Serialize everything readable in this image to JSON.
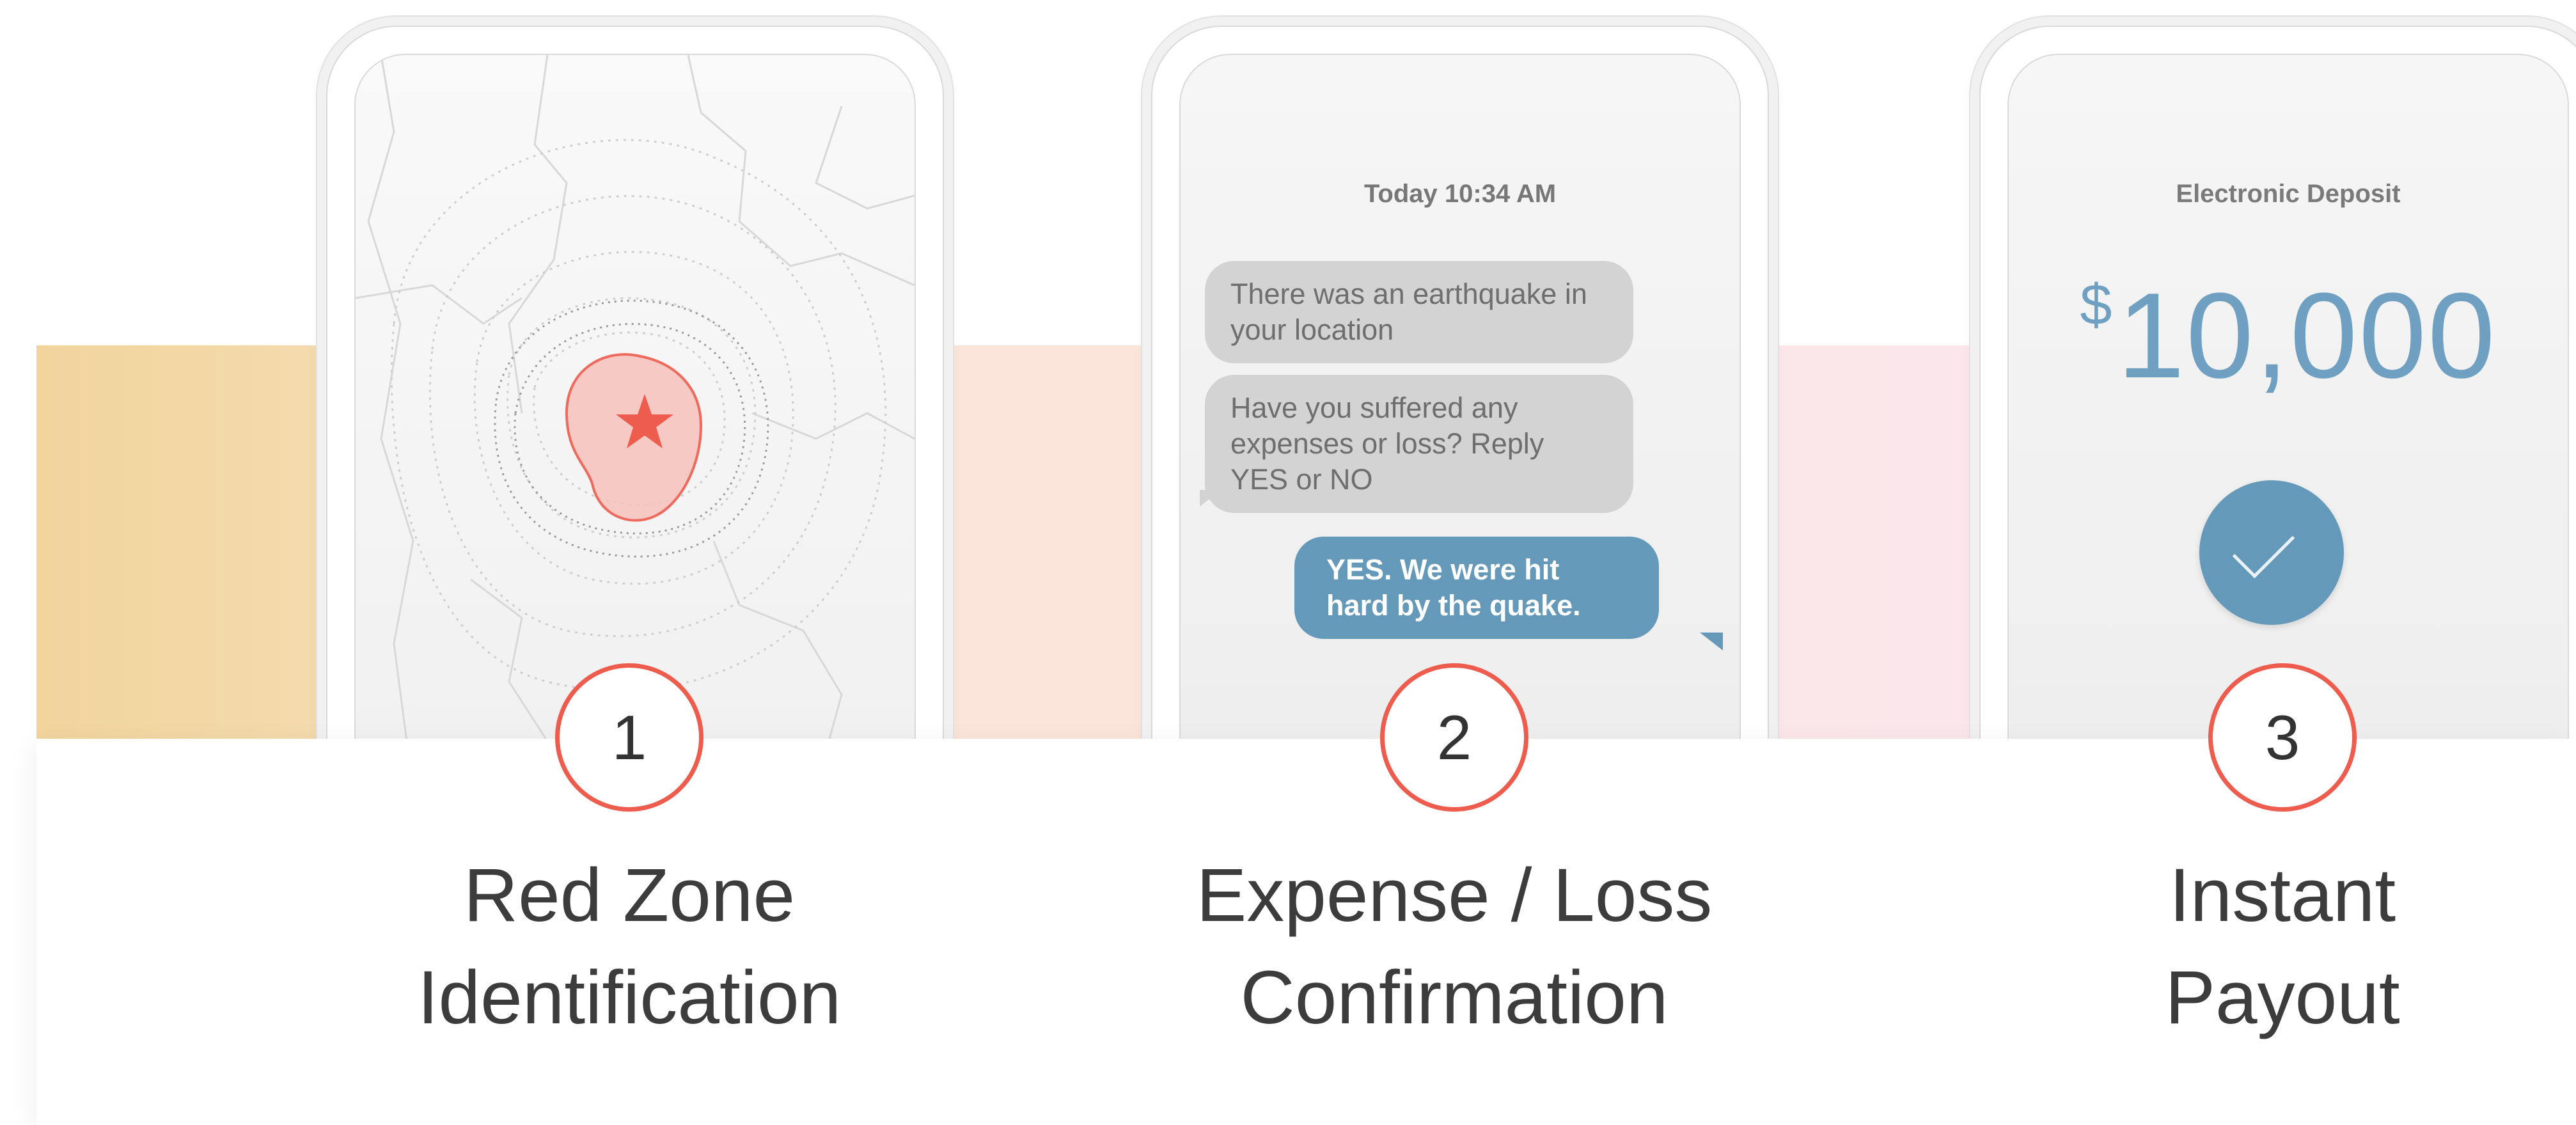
{
  "steps": [
    {
      "number": "1",
      "label_line1": "Red Zone",
      "label_line2": "Identification"
    },
    {
      "number": "2",
      "label_line1": "Expense / Loss",
      "label_line2": "Confirmation"
    },
    {
      "number": "3",
      "label_line1": "Instant",
      "label_line2": "Payout"
    }
  ],
  "chat": {
    "time": "Today 10:34 AM",
    "incoming_1": "There was an earthquake in your location",
    "incoming_2": "Have you suffered any expenses or loss? Reply YES or NO",
    "outgoing": "YES. We were hit hard by the quake."
  },
  "deposit": {
    "title": "Electronic Deposit",
    "currency": "$",
    "amount": "10,000"
  },
  "colors": {
    "accent_red": "#ee5c4e",
    "bubble_blue": "#6599b9",
    "amount_blue": "#6fa0c2",
    "band_yellow": "#f2d49c",
    "band_peach": "#fbe5da",
    "band_pink": "#fbe6ea"
  },
  "icons": {
    "map_marker": "star-icon",
    "deposit_status": "checkmark-icon"
  }
}
